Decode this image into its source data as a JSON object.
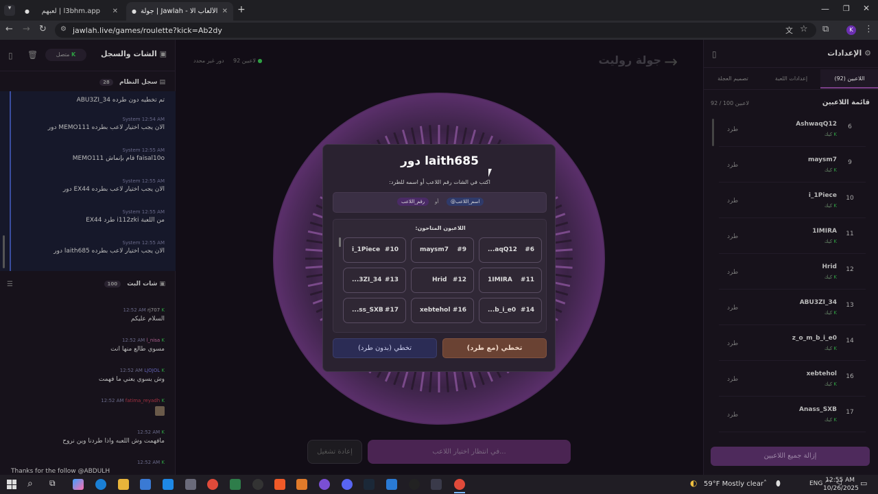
{
  "browser": {
    "tabs": [
      {
        "label": "لعبهم | l3bhm.app"
      },
      {
        "label": "جولة | Jawlah - منصة الألعاب الا..."
      }
    ],
    "url": "jawlah.live/games/roulette?kick=Ab2dy",
    "profile_initial": "K"
  },
  "left_panel": {
    "title": "الشات والسجل",
    "status": "متصل",
    "system_log": {
      "title": "سجل النظام",
      "count": "28",
      "entries": [
        {
          "text": "ABU3ZI_34 تم تخطيه دون طرده",
          "meta": ""
        },
        {
          "text": "دور MEMO111 الان يجب اختيار لاعب بطرده",
          "meta": "System  12:54 AM"
        },
        {
          "text": "MEMO111 قام بإنماش faisal10o",
          "meta": "System  12:55 AM"
        },
        {
          "text": "دور EX44 الان يجب اختيار لاعب بطرده",
          "meta": "System  12:55 AM"
        },
        {
          "text": "EX44 طرد i112zki من اللعبة",
          "meta": "System  12:55 AM"
        },
        {
          "text": "دور laith685 الان يجب اختيار لاعب بطرده",
          "meta": "System  12:55 AM"
        }
      ]
    },
    "live_chat": {
      "title": "شات البث",
      "count": "100",
      "entries": [
        {
          "user": "rj707",
          "time": "12:52 AM",
          "text": "السلام عليكم"
        },
        {
          "user": "l_nisa",
          "time": "12:52 AM",
          "text": "مسوي طالع منها انت"
        },
        {
          "user": "LJOJOL",
          "time": "12:52 AM",
          "text": "وش يسوي يعني ما فهمت"
        },
        {
          "user": "fatima_reyadh",
          "time": "12:52 AM",
          "text": ""
        },
        {
          "user": "",
          "time": "12:52 AM",
          "text": "مافهمت وش اللعبه واذا طردنا وين نروح"
        },
        {
          "user": "",
          "time": "12:52 AM",
          "text": "Thanks for the follow @ABDULH"
        }
      ]
    }
  },
  "center": {
    "title": "جولة روليت",
    "players_count": "92 لاعبين",
    "turn_info": "دور غير محدد",
    "waiting_button": "في انتظار اختيار اللاعب...",
    "restart_button": "إعادة تشغيل"
  },
  "modal": {
    "title": "دور laith685",
    "instruction": "اكتب في الشات رقم اللاعب أو اسمه للطرد:",
    "chip_name": "@اسم_اللاعب",
    "chip_or": "أو",
    "chip_number": "رقم_اللاعب",
    "available_title": "اللاعبون المتاحون:",
    "players": [
      {
        "num": "#6",
        "name": "...aqQ12"
      },
      {
        "num": "#9",
        "name": "maysm7"
      },
      {
        "num": "#10",
        "name": "i_1Piece"
      },
      {
        "num": "#11",
        "name": "1IMIRA"
      },
      {
        "num": "#12",
        "name": "Hrid"
      },
      {
        "num": "#13",
        "name": "...3ZI_34"
      },
      {
        "num": "#14",
        "name": "...b_i_e0"
      },
      {
        "num": "#16",
        "name": "xebtehol"
      },
      {
        "num": "#17",
        "name": "...ss_SXB"
      }
    ],
    "skip_kick": "تخطي (مع طرد)",
    "skip_no_kick": "تخطي (بدون طرد)"
  },
  "right_panel": {
    "title": "الإعدادات",
    "tabs": [
      "اللاعبين (92)",
      "إعدادات اللعبة",
      "تصميم العجلة"
    ],
    "list_title": "قائمة اللاعبين",
    "list_count": "92 / 100 لاعبين",
    "kick_label": "طرد",
    "player_status": "كيك",
    "players": [
      {
        "num": "6",
        "name": "AshwaqQ12"
      },
      {
        "num": "9",
        "name": "maysm7"
      },
      {
        "num": "10",
        "name": "i_1Piece"
      },
      {
        "num": "11",
        "name": "1IMIRA"
      },
      {
        "num": "12",
        "name": "Hrid"
      },
      {
        "num": "13",
        "name": "ABU3ZI_34"
      },
      {
        "num": "14",
        "name": "z_o_m_b_i_e0"
      },
      {
        "num": "16",
        "name": "xebtehol"
      },
      {
        "num": "17",
        "name": "Anass_SXB"
      }
    ],
    "remove_all": "إزالة جميع اللاعبين"
  },
  "taskbar": {
    "weather": "59°F  Mostly clear",
    "lang": "ENG",
    "time": "12:55 AM",
    "date": "10/26/2025"
  },
  "colors": {
    "accent": "#7b3f8a",
    "kick_brown": "#6a4233",
    "skip_blue": "#2b2c55",
    "green": "#2ea043"
  }
}
